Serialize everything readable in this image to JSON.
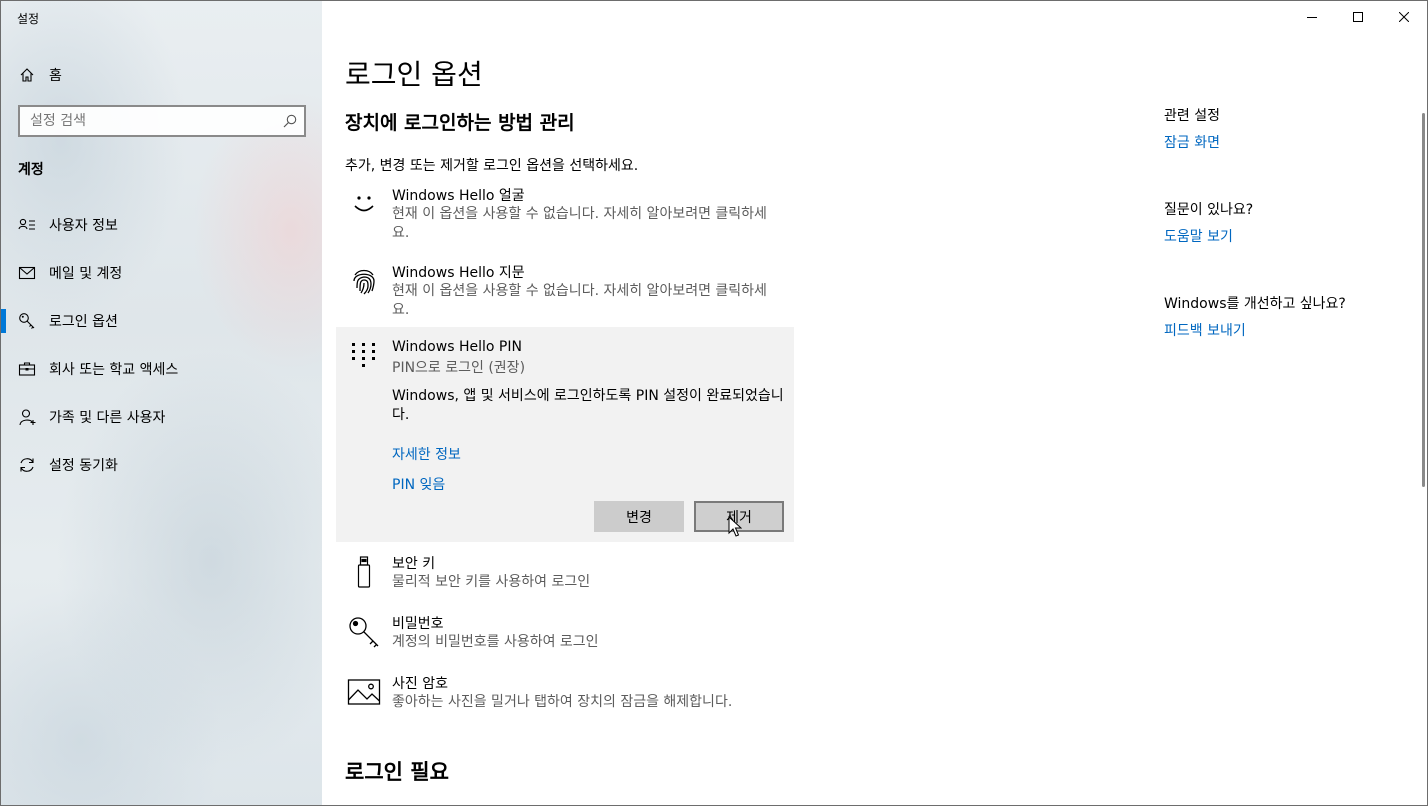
{
  "window": {
    "title": "설정",
    "controls": [
      "minimize",
      "maximize",
      "close"
    ]
  },
  "sidebar": {
    "home_label": "홈",
    "search": {
      "placeholder": "설정 검색"
    },
    "section_label": "계정",
    "items": [
      {
        "label": "사용자 정보",
        "icon": "person-card-icon"
      },
      {
        "label": "메일 및 계정",
        "icon": "mail-icon"
      },
      {
        "label": "로그인 옵션",
        "icon": "key-icon",
        "active": true
      },
      {
        "label": "회사 또는 학교 액세스",
        "icon": "briefcase-icon"
      },
      {
        "label": "가족 및 다른 사용자",
        "icon": "person-add-icon"
      },
      {
        "label": "설정 동기화",
        "icon": "sync-icon"
      }
    ]
  },
  "main": {
    "page_title": "로그인 옵션",
    "subtitle": "장치에 로그인하는 방법 관리",
    "instruction": "추가, 변경 또는 제거할 로그인 옵션을 선택하세요.",
    "options": {
      "face": {
        "title": "Windows Hello 얼굴",
        "desc": "현재 이 옵션을 사용할 수 없습니다. 자세히 알아보려면 클릭하세요.",
        "icon": "smile-face-icon"
      },
      "fingerprint": {
        "title": "Windows Hello 지문",
        "desc": "현재 이 옵션을 사용할 수 없습니다. 자세히 알아보려면 클릭하세요.",
        "icon": "fingerprint-icon"
      },
      "pin": {
        "title": "Windows Hello PIN",
        "subtitle": "PIN으로 로그인 (권장)",
        "message": "Windows, 앱 및 서비스에 로그인하도록 PIN 설정이 완료되었습니다.",
        "link_more": "자세한 정보",
        "link_forgot": "PIN 잊음",
        "change_label": "변경",
        "remove_label": "제거",
        "icon": "keypad-icon"
      },
      "security_key": {
        "title": "보안 키",
        "desc": "물리적 보안 키를 사용하여 로그인",
        "icon": "usb-key-icon"
      },
      "password": {
        "title": "비밀번호",
        "desc": "계정의 비밀번호를 사용하여 로그인",
        "icon": "key-icon"
      },
      "picture": {
        "title": "사진 암호",
        "desc": "좋아하는 사진을 밀거나 탭하여 장치의 잠금을 해제합니다.",
        "icon": "picture-icon"
      }
    },
    "bottom_title": "로그인 필요"
  },
  "related": {
    "heading1": "관련 설정",
    "link1": "잠금 화면",
    "heading2": "질문이 있나요?",
    "link2": "도움말 보기",
    "heading3": "Windows를 개선하고 싶나요?",
    "link3": "피드백 보내기"
  },
  "colors": {
    "accent": "#0078d7",
    "link": "#0067c0",
    "panel_bg": "#f2f2f2",
    "button_bg": "#cccccc"
  }
}
